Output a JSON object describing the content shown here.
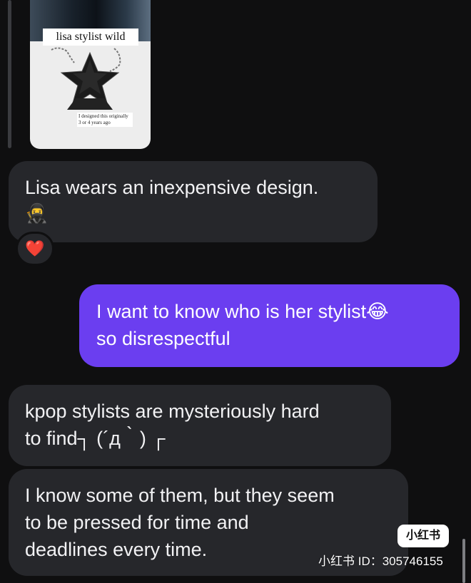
{
  "shared_image": {
    "caption": "lisa stylist wild",
    "note": "I designed this originally 3 or 4 years ago"
  },
  "messages": [
    {
      "direction": "incoming",
      "text": "Lisa wears an inexpensive design.",
      "extra": "🥷",
      "reaction": "❤️"
    },
    {
      "direction": "outgoing",
      "line1": "I want to know who is her stylist😂",
      "line2": "so disrespectful"
    },
    {
      "direction": "incoming",
      "line1": "kpop stylists are mysteriously hard",
      "line2": "to find┐ (´д｀) ┌"
    },
    {
      "direction": "incoming",
      "line1": "I know some of them, but they seem",
      "line2": "to be pressed for time and",
      "line3": "deadlines every time."
    }
  ],
  "watermark": {
    "logo": "小红书",
    "id_text": "小红书 ID：305746155"
  },
  "colors": {
    "background": "#0f0f10",
    "incoming_bubble": "#26272b",
    "outgoing_bubble": "#6b3ef0"
  }
}
